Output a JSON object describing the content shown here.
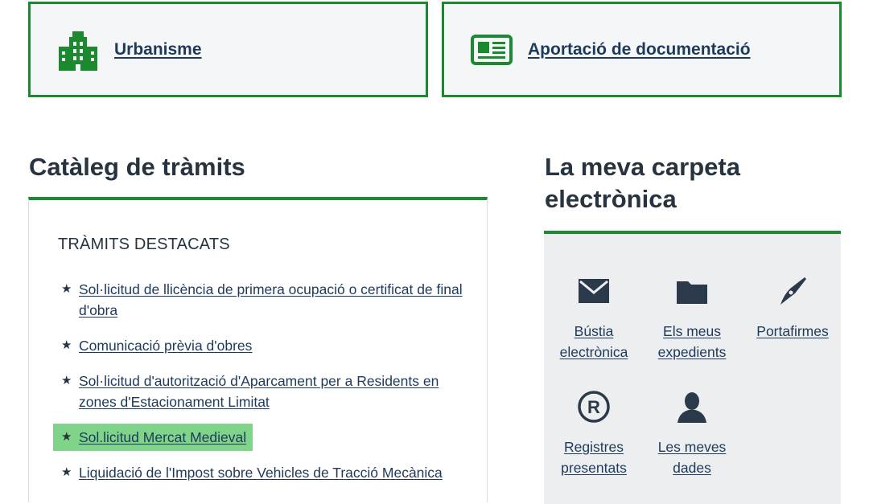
{
  "cards": [
    {
      "label": "Urbanisme",
      "icon": "building-icon"
    },
    {
      "label": "Aportació de documentació",
      "icon": "newspaper-icon"
    }
  ],
  "catalog": {
    "title": "Catàleg de tràmits",
    "subtitle": "TRÀMITS DESTACATS",
    "items": [
      {
        "label": "Sol·licitud de llicència de primera ocupació o certificat de final d'obra"
      },
      {
        "label": "Comunicació prèvia d'obres"
      },
      {
        "label": "Sol·licitud d'autorització d'Aparcament per a Residents en zones d'Estacionament Limitat"
      },
      {
        "label": "Sol.licitud Mercat Medieval",
        "highlighted": true
      },
      {
        "label": "Liquidació de l'Impost sobre Vehicles de Tracció Mecànica"
      }
    ]
  },
  "carpeta": {
    "title": "La meva carpeta electrònica",
    "tiles": [
      {
        "label": "Bústia electrònica",
        "icon": "envelope-icon"
      },
      {
        "label": "Els meus expedients",
        "icon": "folder-icon"
      },
      {
        "label": "Portafirmes",
        "icon": "pen-nib-icon"
      },
      {
        "label": "Registres presentats",
        "icon": "registered-icon"
      },
      {
        "label": "Les meves dades",
        "icon": "user-icon"
      }
    ]
  },
  "colors": {
    "accent": "#1b8a2e",
    "link": "#1d3a5c",
    "highlight": "#7fd48a"
  }
}
